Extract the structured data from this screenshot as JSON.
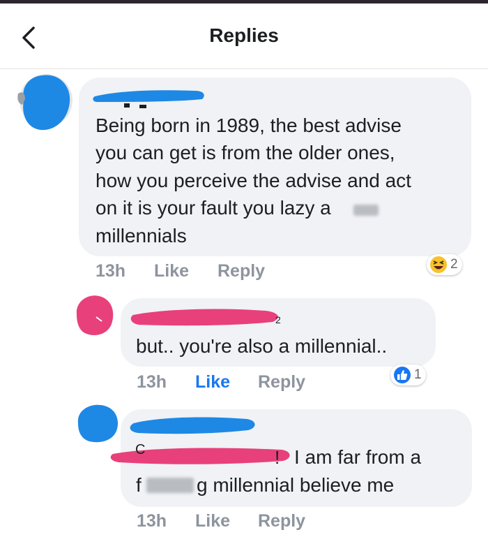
{
  "header": {
    "title": "Replies"
  },
  "comments": [
    {
      "lines": [
        "Being born in 1989, the best advise",
        "you can get is from the older ones,",
        "how you perceive the advise and act",
        "on it is your fault you lazy a",
        "millennials"
      ],
      "time": "13h",
      "like_label": "Like",
      "reply_label": "Reply",
      "reaction_icon": "laughing-emoji-icon",
      "reaction_count": "2"
    },
    {
      "lines": [
        "but.. you're also a millennial.."
      ],
      "time": "13h",
      "like_label": "Like",
      "reply_label": "Reply",
      "reaction_icon": "thumbs-up-icon",
      "reaction_count": "1",
      "liked": true
    },
    {
      "lines": [
        "I am far from a",
        "f",
        "g millennial believe me"
      ],
      "time": "13h",
      "like_label": "Like",
      "reply_label": "Reply"
    }
  ],
  "colors": {
    "bubble": "#f0f2f5",
    "meta": "#8d949e",
    "like_active": "#1877f2",
    "redact_blue": "#1e88e5",
    "redact_pink": "#e8407a"
  }
}
